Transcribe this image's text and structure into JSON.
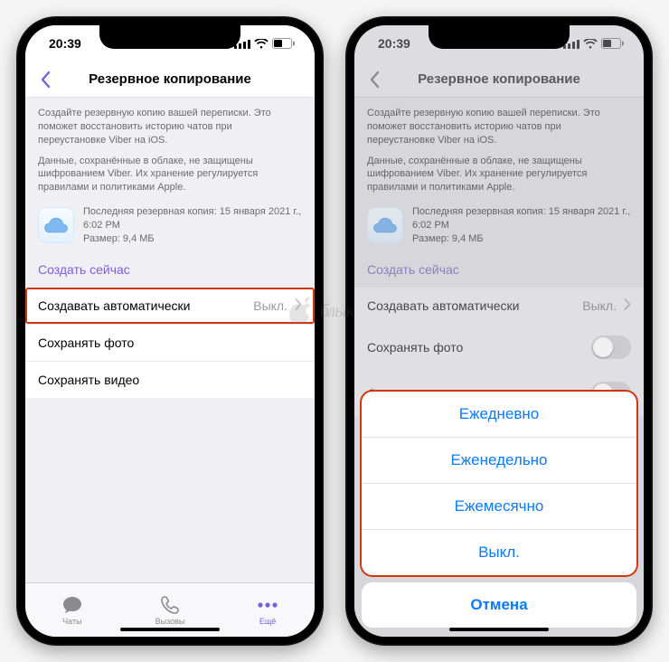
{
  "status": {
    "time": "20:39"
  },
  "header": {
    "title": "Резервное копирование"
  },
  "desc": {
    "p1": "Создайте резервную копию вашей переписки. Это поможет восстановить историю чатов при переустановке Viber на iOS.",
    "p2": "Данные, сохранённые в облаке, не защищены шифрованием Viber. Их хранение регулируется правилами и политиками Apple."
  },
  "backup": {
    "line1": "Последняя резервная копия: 15 января 2021 г.,",
    "line2": "6:02 PM",
    "line3": "Размер: 9,4 МБ"
  },
  "actions": {
    "create_now": "Создать сейчас"
  },
  "rows": {
    "auto": "Создавать автоматически",
    "auto_value": "Выкл.",
    "photo": "Сохранять фото",
    "video": "Сохранять видео"
  },
  "tabs": {
    "chats": "Чаты",
    "calls": "Вызовы",
    "more": "Ещё"
  },
  "sheet": {
    "daily": "Ежедневно",
    "weekly": "Еженедельно",
    "monthly": "Ежемесячно",
    "off": "Выкл.",
    "cancel": "Отмена"
  },
  "watermark": "блык"
}
